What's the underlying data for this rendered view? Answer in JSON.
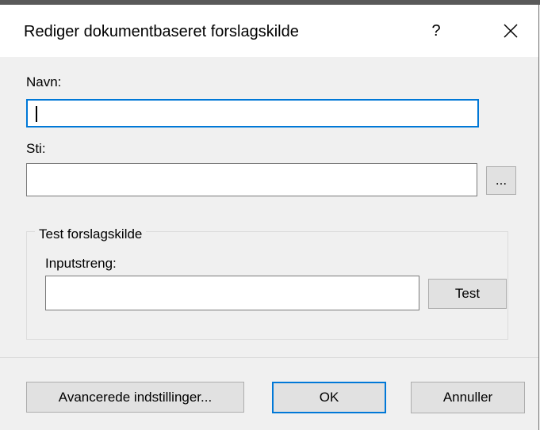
{
  "window": {
    "title": "Rediger dokumentbaseret forslagskilde",
    "help_label": "?",
    "close_icon": "close-icon"
  },
  "fields": {
    "name_label": "Navn:",
    "name_value": "",
    "path_label": "Sti:",
    "path_value": "",
    "browse_label": "..."
  },
  "test_group": {
    "title": "Test forslagskilde",
    "input_label": "Inputstreng:",
    "input_value": "",
    "test_button": "Test"
  },
  "footer": {
    "advanced_button": "Avancerede indstillinger...",
    "ok_button": "OK",
    "cancel_button": "Annuller"
  },
  "colors": {
    "accent": "#0078d7",
    "dialog_bg": "#f0f0f0",
    "button_bg": "#e1e1e1"
  }
}
